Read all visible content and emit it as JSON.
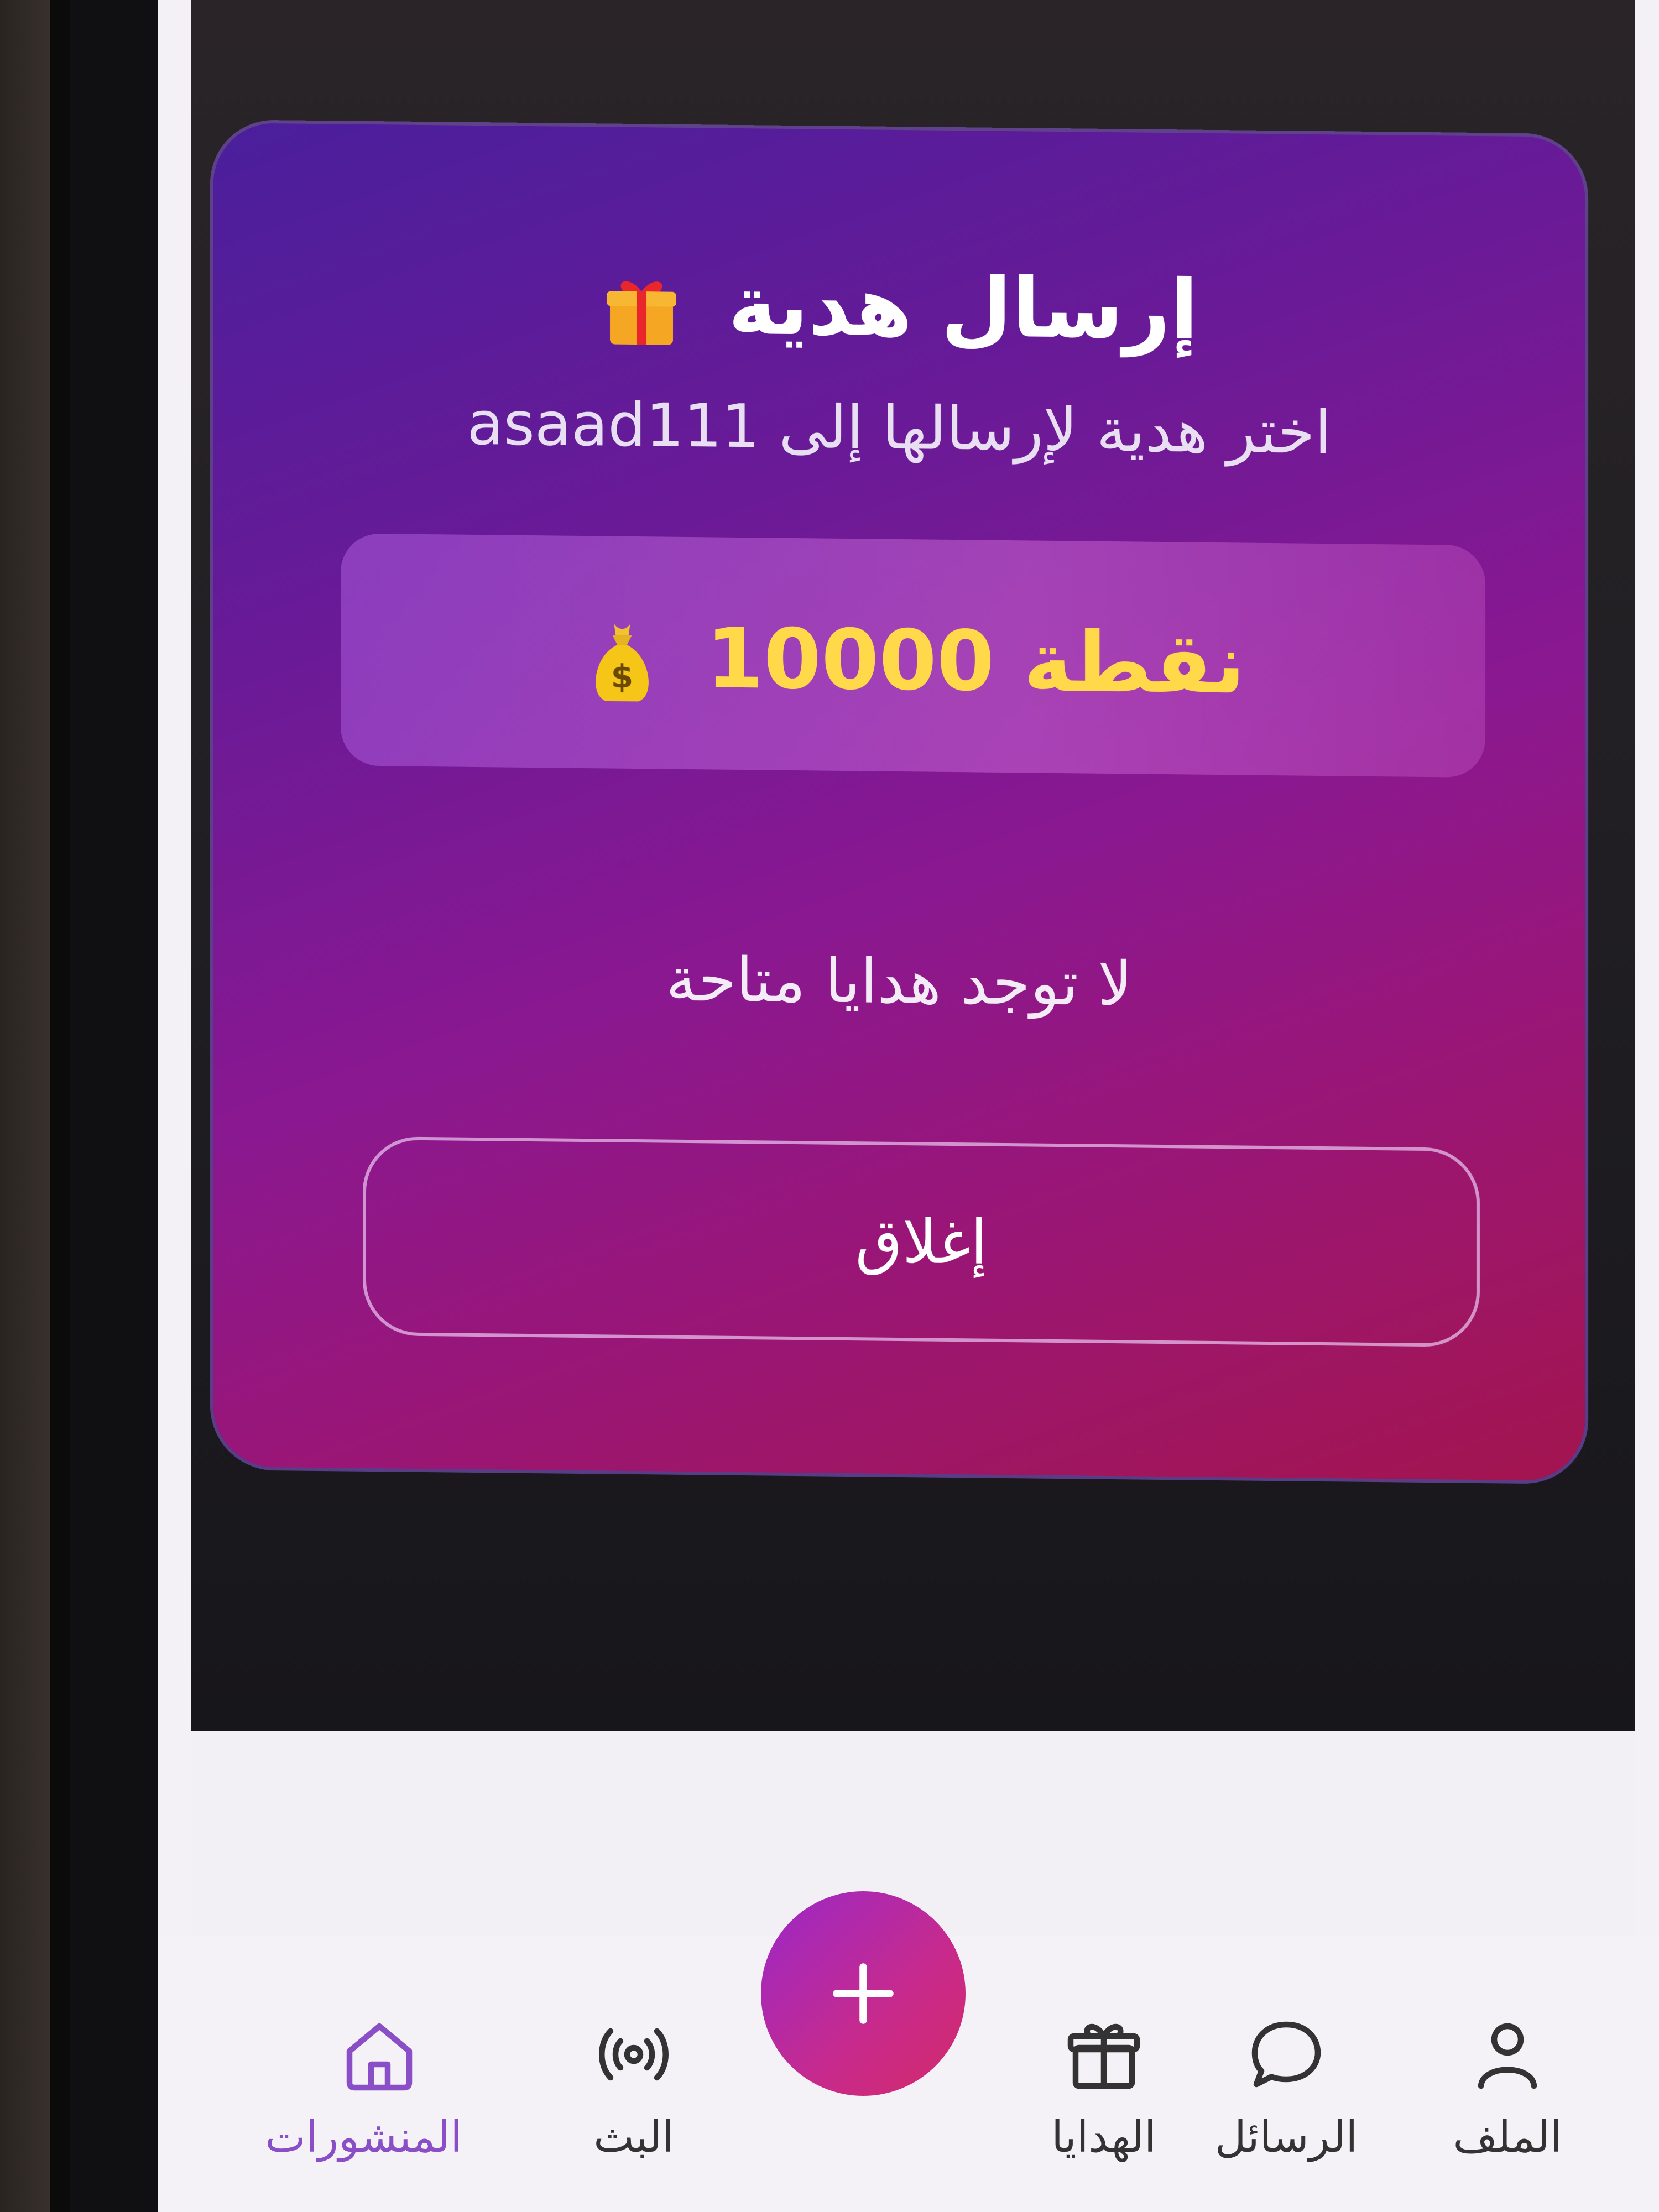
{
  "modal": {
    "title": "إرسال هدية",
    "title_icon": "gift-icon",
    "subtitle": "اختر هدية لإرسالها إلى asaad111",
    "points": "نقطة 10000",
    "points_icon": "money-bag-icon",
    "empty_text": "لا توجد هدايا متاحة",
    "close_label": "إغلاق",
    "colors": {
      "gradient_start": "#4a1f9c",
      "gradient_end": "#a3154f",
      "points_color": "#ffd94a"
    }
  },
  "bottom_nav": {
    "items": [
      {
        "label": "الملف",
        "icon": "profile-icon"
      },
      {
        "label": "الرسائل",
        "icon": "chat-icon"
      },
      {
        "label": "الهدايا",
        "icon": "gift-icon"
      },
      {
        "label": "",
        "icon": "plus-icon"
      },
      {
        "label": "البث",
        "icon": "broadcast-icon"
      },
      {
        "label": "المنشورات",
        "icon": "home-icon"
      }
    ],
    "accent": "#8a4fc6"
  }
}
